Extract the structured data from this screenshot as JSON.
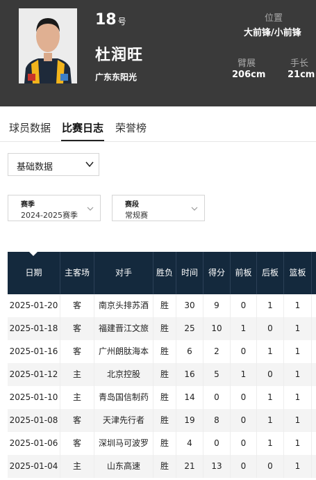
{
  "player": {
    "number": "18",
    "number_suffix": "号",
    "name": "杜润旺",
    "team": "广东东阳光",
    "position_label": "位置",
    "position_value": "大前锋/小前锋",
    "wingspan_label": "臂展",
    "wingspan_value": "206cm",
    "hand_label": "手长",
    "hand_value": "21cm"
  },
  "colors": {
    "header_bg": "#3a3a3a",
    "table_header_bg": "#14293d"
  },
  "tabs": [
    {
      "label": "球员数据"
    },
    {
      "label": "比赛日志",
      "active": true
    },
    {
      "label": "荣誉榜"
    }
  ],
  "filters": {
    "stat_type": "基础数据",
    "season_label": "赛季",
    "season_value": "2024-2025赛季",
    "stage_label": "赛段",
    "stage_value": "常规赛"
  },
  "table": {
    "headers": [
      "日期",
      "主客场",
      "对手",
      "胜负",
      "时间",
      "得分",
      "前板",
      "后板",
      "篮板"
    ],
    "rows": [
      [
        "2025-01-20",
        "客",
        "南京头排苏酒",
        "胜",
        "30",
        "9",
        "0",
        "1",
        "1"
      ],
      [
        "2025-01-18",
        "客",
        "福建晋江文旅",
        "胜",
        "25",
        "10",
        "1",
        "0",
        "1"
      ],
      [
        "2025-01-16",
        "客",
        "广州朗肽海本",
        "胜",
        "6",
        "2",
        "0",
        "1",
        "1"
      ],
      [
        "2025-01-12",
        "主",
        "北京控股",
        "胜",
        "16",
        "5",
        "1",
        "0",
        "1"
      ],
      [
        "2025-01-10",
        "主",
        "青岛国信制药",
        "胜",
        "14",
        "0",
        "0",
        "1",
        "1"
      ],
      [
        "2025-01-08",
        "客",
        "天津先行者",
        "胜",
        "19",
        "8",
        "0",
        "1",
        "1"
      ],
      [
        "2025-01-06",
        "客",
        "深圳马可波罗",
        "胜",
        "4",
        "0",
        "0",
        "1",
        "1"
      ],
      [
        "2025-01-04",
        "主",
        "山东高速",
        "胜",
        "21",
        "13",
        "0",
        "0",
        "1"
      ]
    ]
  }
}
